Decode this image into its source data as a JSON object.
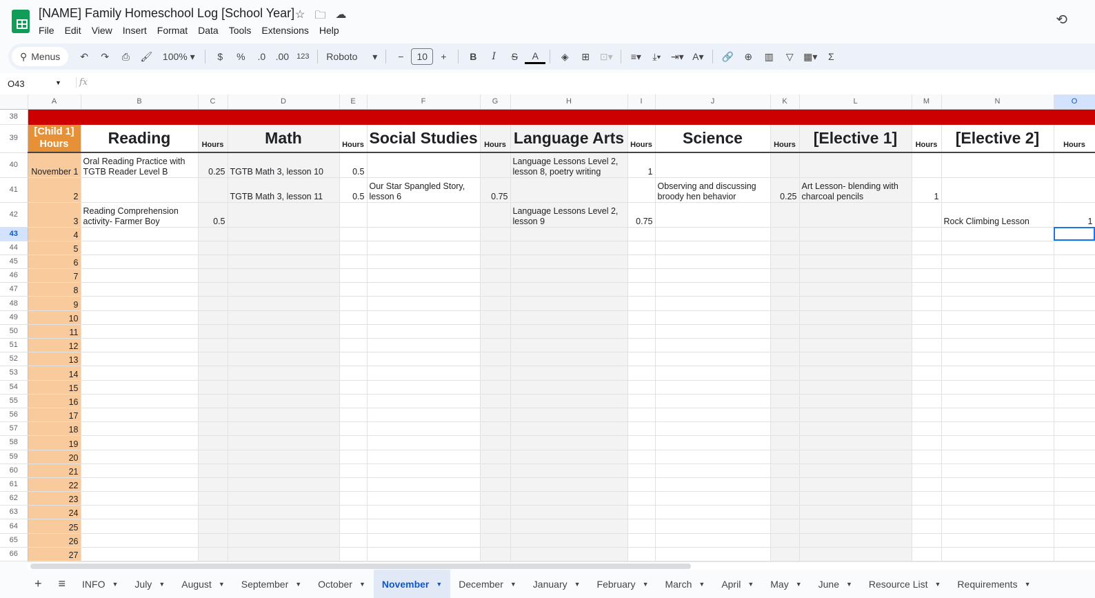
{
  "doc": {
    "title": "[NAME] Family Homeschool Log [School Year]"
  },
  "menu": [
    "File",
    "Edit",
    "View",
    "Insert",
    "Format",
    "Data",
    "Tools",
    "Extensions",
    "Help"
  ],
  "toolbar": {
    "search": "Menus",
    "zoom": "100%",
    "currency": "$",
    "percent": "%",
    "dec_less": ".0",
    "dec_more": ".00",
    "format123": "123",
    "font": "Roboto",
    "font_size": "10"
  },
  "formula_bar": {
    "cell_ref": "O43",
    "fx": "fx",
    "value": ""
  },
  "columns": [
    "A",
    "B",
    "C",
    "D",
    "E",
    "F",
    "G",
    "H",
    "I",
    "J",
    "K",
    "L",
    "M",
    "N",
    "O"
  ],
  "selected_column": "O",
  "header_row": {
    "row": "39",
    "cells": [
      "[Child 1] Hours",
      "Reading",
      "Hours",
      "Math",
      "Hours",
      "Social Studies",
      "Hours",
      "Language Arts",
      "Hours",
      "Science",
      "Hours",
      "[Elective 1]",
      "Hours",
      "[Elective 2]",
      "Hours"
    ]
  },
  "red_row": "38",
  "rows": [
    {
      "row": "40",
      "cells": [
        "November 1",
        "Oral Reading Practice with TGTB Reader Level B",
        "0.25",
        "TGTB Math 3, lesson 10",
        "0.5",
        "",
        "",
        "Language Lessons Level 2, lesson 8, poetry writing",
        "1",
        "",
        "",
        "",
        "",
        "",
        ""
      ]
    },
    {
      "row": "41",
      "cells": [
        "2",
        "",
        "",
        "TGTB Math 3, lesson 11",
        "0.5",
        "Our Star Spangled Story, lesson 6",
        "0.75",
        "",
        "",
        "Observing and discussing broody hen behavior",
        "0.25",
        "Art Lesson- blending with charcoal pencils",
        "1",
        "",
        ""
      ]
    },
    {
      "row": "42",
      "cells": [
        "3",
        "Reading Comprehension activity- Farmer Boy",
        "0.5",
        "",
        "",
        "",
        "",
        "Language Lessons Level 2, lesson 9",
        "0.75",
        "",
        "",
        "",
        "",
        "Rock Climbing Lesson",
        "1"
      ]
    },
    {
      "row": "43",
      "cells": [
        "4"
      ]
    },
    {
      "row": "44",
      "cells": [
        "5"
      ]
    },
    {
      "row": "45",
      "cells": [
        "6"
      ]
    },
    {
      "row": "46",
      "cells": [
        "7"
      ]
    },
    {
      "row": "47",
      "cells": [
        "8"
      ]
    },
    {
      "row": "48",
      "cells": [
        "9"
      ]
    },
    {
      "row": "49",
      "cells": [
        "10"
      ]
    },
    {
      "row": "50",
      "cells": [
        "11"
      ]
    },
    {
      "row": "51",
      "cells": [
        "12"
      ]
    },
    {
      "row": "52",
      "cells": [
        "13"
      ]
    },
    {
      "row": "53",
      "cells": [
        "14"
      ]
    },
    {
      "row": "54",
      "cells": [
        "15"
      ]
    },
    {
      "row": "55",
      "cells": [
        "16"
      ]
    },
    {
      "row": "56",
      "cells": [
        "17"
      ]
    },
    {
      "row": "57",
      "cells": [
        "18"
      ]
    },
    {
      "row": "58",
      "cells": [
        "19"
      ]
    },
    {
      "row": "59",
      "cells": [
        "20"
      ]
    },
    {
      "row": "60",
      "cells": [
        "21"
      ]
    },
    {
      "row": "61",
      "cells": [
        "22"
      ]
    },
    {
      "row": "62",
      "cells": [
        "23"
      ]
    },
    {
      "row": "63",
      "cells": [
        "24"
      ]
    },
    {
      "row": "64",
      "cells": [
        "25"
      ]
    },
    {
      "row": "65",
      "cells": [
        "26"
      ]
    },
    {
      "row": "66",
      "cells": [
        "27"
      ]
    }
  ],
  "selected_row": "43",
  "sheet_tabs": [
    "INFO",
    "July",
    "August",
    "September",
    "October",
    "November",
    "December",
    "January",
    "February",
    "March",
    "April",
    "May",
    "June",
    "Resource List",
    "Requirements"
  ],
  "active_tab": "November",
  "colors": {
    "red": "#cc0000",
    "orange": "#e69138",
    "peach": "#f9cb9c",
    "shade": "#f3f3f3"
  }
}
